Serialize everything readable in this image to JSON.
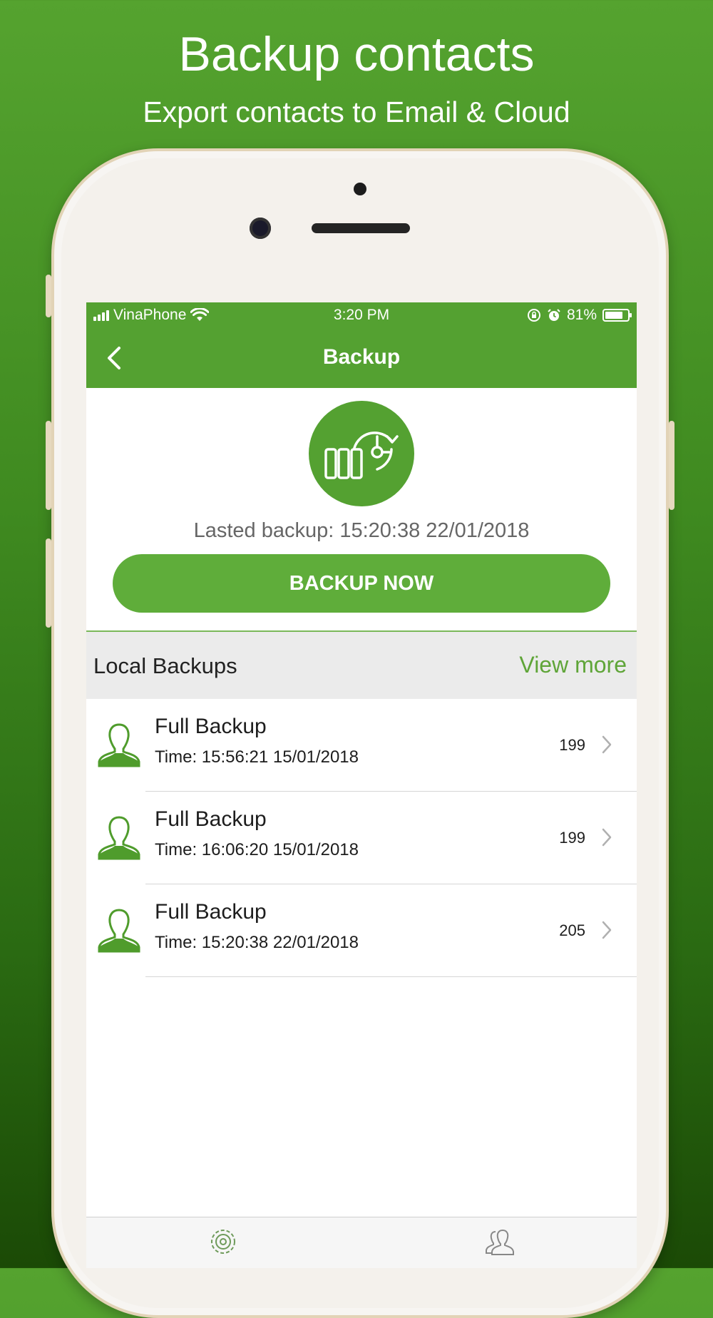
{
  "promo": {
    "title": "Backup contacts",
    "subtitle": "Export contacts to Email & Cloud"
  },
  "status_bar": {
    "carrier": "VinaPhone",
    "time": "3:20 PM",
    "battery": "81%",
    "battery_level": 0.81
  },
  "nav": {
    "back_icon": "chevron-left-icon",
    "title": "Backup"
  },
  "backup": {
    "logo_icon": "backup-restore-icon",
    "last_backup": "Lasted backup: 15:20:38 22/01/2018",
    "button_label": "BACKUP NOW"
  },
  "local_backups": {
    "title": "Local Backups",
    "view_more": "View more",
    "items": [
      {
        "title": "Full Backup",
        "time": "Time: 15:56:21 15/01/2018",
        "count": "199"
      },
      {
        "title": "Full Backup",
        "time": "Time: 16:06:20 15/01/2018",
        "count": "199"
      },
      {
        "title": "Full Backup",
        "time": "Time: 15:20:38 22/01/2018",
        "count": "205"
      }
    ]
  },
  "tab_bar": {
    "tabs": [
      {
        "icon": "gear-icon"
      },
      {
        "icon": "contacts-icon"
      }
    ]
  },
  "colors": {
    "accent": "#54a131",
    "link": "#5fa538",
    "section_bg": "#ebebeb"
  }
}
